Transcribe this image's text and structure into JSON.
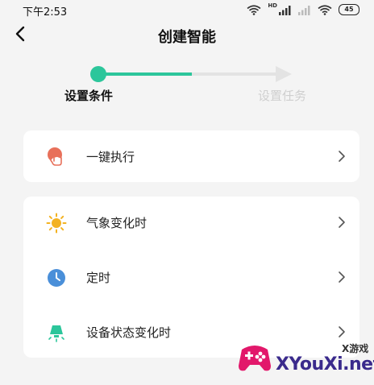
{
  "status_bar": {
    "time": "下午2:53",
    "icons": [
      "wifi-icon",
      "signal-hd-icon",
      "signal-icon",
      "wifi-icon",
      "battery-icon"
    ],
    "hd_label": "HD",
    "battery_level": "45"
  },
  "header": {
    "title": "创建智能",
    "back_icon": "chevron-left-icon"
  },
  "stepper": {
    "steps": [
      {
        "label": "设置条件",
        "state": "active"
      },
      {
        "label": "设置任务",
        "state": "inactive"
      }
    ],
    "colors": {
      "active": "#2cc69b",
      "inactive": "#e3e3e3"
    }
  },
  "cards": [
    {
      "items": [
        {
          "label": "一键执行",
          "icon": "tap-hand-icon",
          "icon_color": "#e8705a"
        }
      ]
    },
    {
      "items": [
        {
          "label": "气象变化时",
          "icon": "sun-icon",
          "icon_color": "#f3b221"
        },
        {
          "label": "定时",
          "icon": "clock-icon",
          "icon_color": "#4a8fd9"
        },
        {
          "label": "设备状态变化时",
          "icon": "lamp-icon",
          "icon_color": "#2cc69b"
        }
      ]
    }
  ],
  "watermark": {
    "small_text": "X游戏",
    "big_text": "XYouXi.net"
  }
}
